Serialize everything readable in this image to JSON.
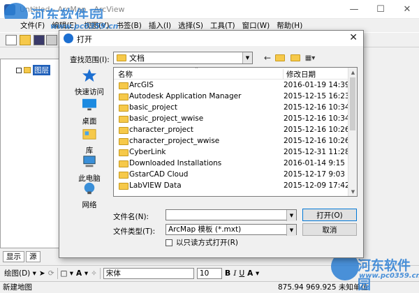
{
  "app": {
    "title": "Untitled - ArcMap - ArcView",
    "watermark_brand": "河东软件园",
    "watermark_url": "www.pc0359.cn"
  },
  "menu": [
    "文件(F)",
    "编辑(E)",
    "视图(V)",
    "书签(B)",
    "插入(I)",
    "选择(S)",
    "工具(T)",
    "窗口(W)",
    "帮助(H)"
  ],
  "toc": {
    "root_label": "图层",
    "tabs": [
      "显示",
      "源"
    ]
  },
  "draw_toolbar": {
    "drawing_label": "绘图(D) ▾",
    "font_name": "宋体",
    "font_size": "10",
    "bold": "B",
    "italic": "I",
    "underline": "U"
  },
  "status": {
    "text": "新建地图",
    "coords": "875.94  969.925 未知单位"
  },
  "dialog": {
    "title": "打开",
    "lookin_label": "查找范围(I):",
    "lookin_value": "文档",
    "places": [
      {
        "label": "快速访问",
        "icon": "star-icon"
      },
      {
        "label": "桌面",
        "icon": "desktop-icon"
      },
      {
        "label": "库",
        "icon": "library-icon"
      },
      {
        "label": "此电脑",
        "icon": "computer-icon"
      },
      {
        "label": "网络",
        "icon": "network-icon"
      }
    ],
    "columns": {
      "name": "名称",
      "date": "修改日期"
    },
    "files": [
      {
        "name": "ArcGIS",
        "date": "2016-01-19 14:39"
      },
      {
        "name": "Autodesk Application Manager",
        "date": "2015-12-15 16:23"
      },
      {
        "name": "basic_project",
        "date": "2015-12-16 10:34"
      },
      {
        "name": "basic_project_wwise",
        "date": "2015-12-16 10:34"
      },
      {
        "name": "character_project",
        "date": "2015-12-16 10:26"
      },
      {
        "name": "character_project_wwise",
        "date": "2015-12-16 10:26"
      },
      {
        "name": "CyberLink",
        "date": "2015-12-31 11:28"
      },
      {
        "name": "Downloaded Installations",
        "date": "2016-01-14 9:15"
      },
      {
        "name": "GstarCAD Cloud",
        "date": "2015-12-17 9:03"
      },
      {
        "name": "LabVIEW Data",
        "date": "2015-12-09 17:42"
      }
    ],
    "filename_label": "文件名(N):",
    "filename_value": "",
    "filetype_label": "文件类型(T):",
    "filetype_value": "ArcMap 模板 (*.mxt)",
    "open_button": "打开(O)",
    "cancel_button": "取消",
    "readonly_label": "以只读方式打开(R)"
  }
}
